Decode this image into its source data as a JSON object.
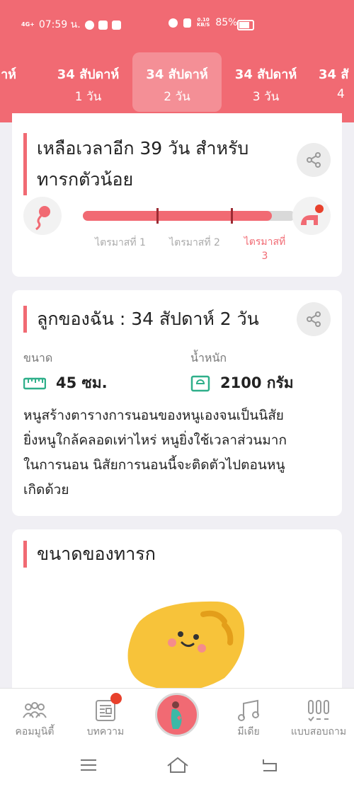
{
  "status_bar": {
    "signal": "4G+",
    "time": "07:59 น.",
    "speed_value": "0.10",
    "speed_unit": "KB/S",
    "battery": "85%"
  },
  "weeks": [
    {
      "l1": "ปดาห์",
      "l2": ""
    },
    {
      "l1": "34 สัปดาห์",
      "l2": "1 วัน"
    },
    {
      "l1": "34 สัปดาห์",
      "l2": "2 วัน"
    },
    {
      "l1": "34 สัปดาห์",
      "l2": "3 วัน"
    },
    {
      "l1": "34 สั",
      "l2": "4"
    }
  ],
  "countdown_card": {
    "title_line1": "เหลือเวลาอีก 39 วัน สำหรับ",
    "title_line2": "ทารกตัวน้อย",
    "progress_fraction": 0.89,
    "trimesters": [
      "ไตรมาสที่ 1",
      "ไตรมาสที่ 2",
      "ไตรมาสที่"
    ],
    "trimester_3_number": "3"
  },
  "baby_card": {
    "title": "ลูกของฉัน : 34 สัปดาห์ 2  วัน",
    "size_label": "ขนาด",
    "size_value": "45 ซม.",
    "weight_label": "น้ำหนัก",
    "weight_value": "2100 กรัม",
    "description_lines": [
      "หนูสร้างตารางการนอนของหนูเองจนเป็นนิสัย",
      "ยิ่งหนูใกล้คลอดเท่าไหร่ หนูยิ่งใช้เวลาส่วนมาก",
      "ในการนอน นิสัยการนอนนี้จะติดตัวไปตอนหนู",
      "เกิดด้วย"
    ]
  },
  "size_card": {
    "title": "ขนาดของทารก"
  },
  "bottom_nav": {
    "community": "คอมมูนิตี้",
    "articles": "บทความ",
    "media": "มีเดีย",
    "quiz": "แบบสอบถาม"
  },
  "colors": {
    "accent": "#f16a73",
    "background": "#f0eff4",
    "icon_green": "#2faf8a"
  }
}
